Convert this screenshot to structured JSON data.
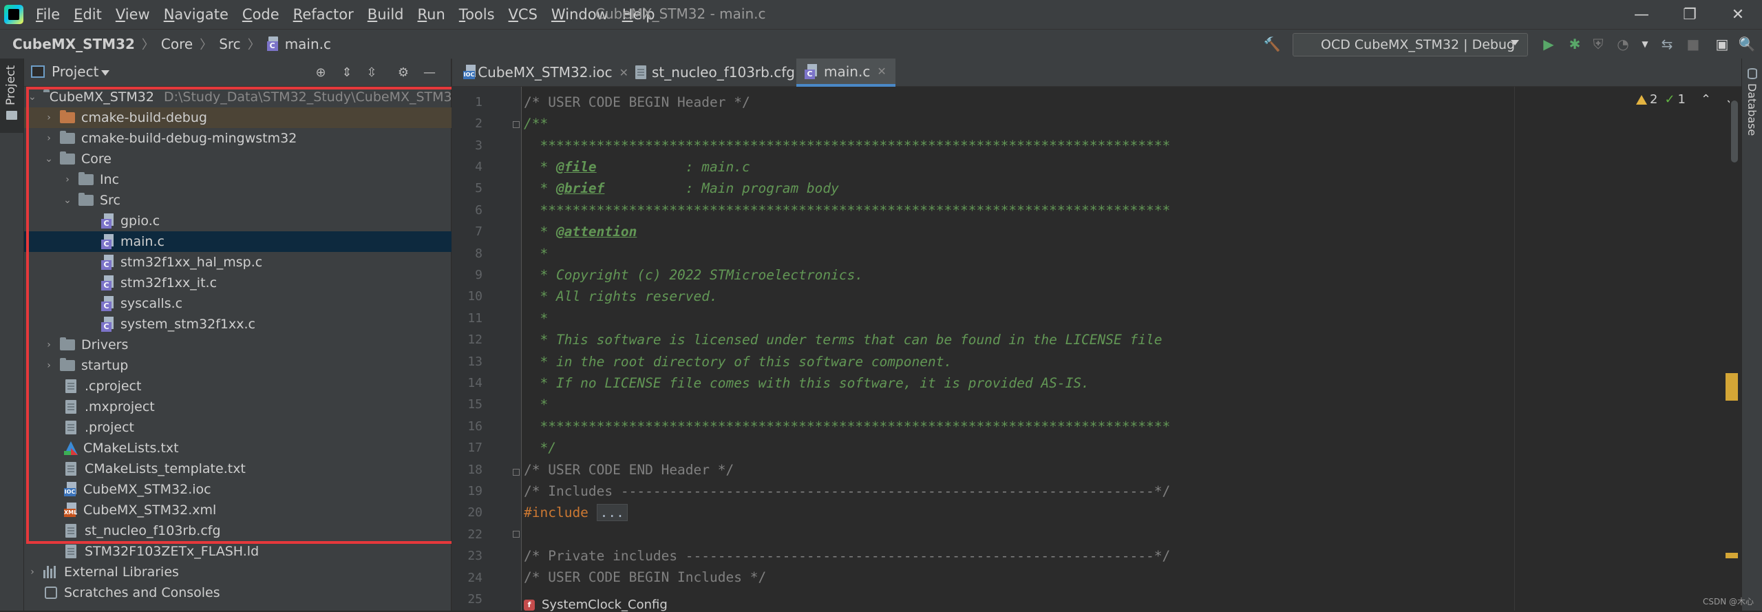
{
  "window": {
    "title": "CubeMX_STM32 - main.c",
    "menu": [
      {
        "mnemonic": "F",
        "rest": "ile"
      },
      {
        "mnemonic": "E",
        "rest": "dit"
      },
      {
        "mnemonic": "V",
        "rest": "iew"
      },
      {
        "mnemonic": "N",
        "rest": "avigate"
      },
      {
        "mnemonic": "C",
        "rest": "ode"
      },
      {
        "mnemonic": "R",
        "rest": "efactor"
      },
      {
        "mnemonic": "B",
        "rest": "uild"
      },
      {
        "mnemonic": "R",
        "rest": "un"
      },
      {
        "mnemonic": "T",
        "rest": "ools"
      },
      {
        "mnemonic": "V",
        "rest": "CS"
      },
      {
        "mnemonic": "W",
        "rest": "indow"
      },
      {
        "mnemonic": "H",
        "rest": "elp"
      }
    ],
    "controls": {
      "minimize": "—",
      "maximize": "❐",
      "close": "✕"
    }
  },
  "navbar": {
    "breadcrumb": [
      "CubeMX_STM32",
      "Core",
      "Src",
      "main.c"
    ],
    "run_config": "OCD CubeMX_STM32 | Debug"
  },
  "side_strip": {
    "left_label": "Project",
    "right_label": "Database"
  },
  "project": {
    "title": "Project",
    "root": {
      "name": "CubeMX_STM32",
      "path": "D:\\Study_Data\\STM32_Study\\CubeMX_STM32"
    },
    "items": [
      {
        "label": "cmake-build-debug"
      },
      {
        "label": "cmake-build-debug-mingwstm32"
      },
      {
        "label": "Core"
      },
      {
        "label": "Inc"
      },
      {
        "label": "Src"
      },
      {
        "label": "gpio.c"
      },
      {
        "label": "main.c"
      },
      {
        "label": "stm32f1xx_hal_msp.c"
      },
      {
        "label": "stm32f1xx_it.c"
      },
      {
        "label": "syscalls.c"
      },
      {
        "label": "system_stm32f1xx.c"
      },
      {
        "label": "Drivers"
      },
      {
        "label": "startup"
      },
      {
        "label": ".cproject"
      },
      {
        "label": ".mxproject"
      },
      {
        "label": ".project"
      },
      {
        "label": "CMakeLists.txt"
      },
      {
        "label": "CMakeLists_template.txt"
      },
      {
        "label": "CubeMX_STM32.ioc"
      },
      {
        "label": "CubeMX_STM32.xml"
      },
      {
        "label": "st_nucleo_f103rb.cfg"
      },
      {
        "label": "STM32F103ZETx_FLASH.ld"
      },
      {
        "label": "External Libraries"
      },
      {
        "label": "Scratches and Consoles"
      }
    ]
  },
  "editor": {
    "tabs": [
      {
        "label": "CubeMX_STM32.ioc"
      },
      {
        "label": "st_nucleo_f103rb.cfg"
      },
      {
        "label": "main.c"
      }
    ],
    "line_numbers": [
      "1",
      "2",
      "3",
      "4",
      "5",
      "6",
      "7",
      "8",
      "9",
      "10",
      "11",
      "12",
      "13",
      "14",
      "15",
      "16",
      "17",
      "18",
      "19",
      "20",
      "22",
      "23",
      "24",
      "25"
    ],
    "code": {
      "l1": "/* USER CODE BEGIN Header */",
      "l2": "/**",
      "l3": "  ******************************************************************************",
      "l4_pre": "  * ",
      "l4_tag": "@file",
      "l4_post": "           : main.c",
      "l5_pre": "  * ",
      "l5_tag": "@brief",
      "l5_post": "          : Main program body",
      "l6": "  ******************************************************************************",
      "l7_pre": "  * ",
      "l7_tag": "@attention",
      "l8": "  *",
      "l9": "  * Copyright (c) 2022 STMicroelectronics.",
      "l10": "  * All rights reserved.",
      "l11": "  *",
      "l12": "  * This software is licensed under terms that can be found in the LICENSE file",
      "l13": "  * in the root directory of this software component.",
      "l14": "  * If no LICENSE file comes with this software, it is provided AS-IS.",
      "l15": "  *",
      "l16": "  ******************************************************************************",
      "l17": "  */",
      "l18": "/* USER CODE END Header */",
      "l19": "/* Includes ------------------------------------------------------------------*/",
      "l20_kw": "#include",
      "l20_dots": "...",
      "l23": "/* Private includes ----------------------------------------------------------*/",
      "l24": "/* USER CODE BEGIN Includes */"
    },
    "inspections": {
      "warnings": "2",
      "ok": "1"
    },
    "bottom_breadcrumb": "SystemClock_Config"
  },
  "watermark": "CSDN @木心"
}
